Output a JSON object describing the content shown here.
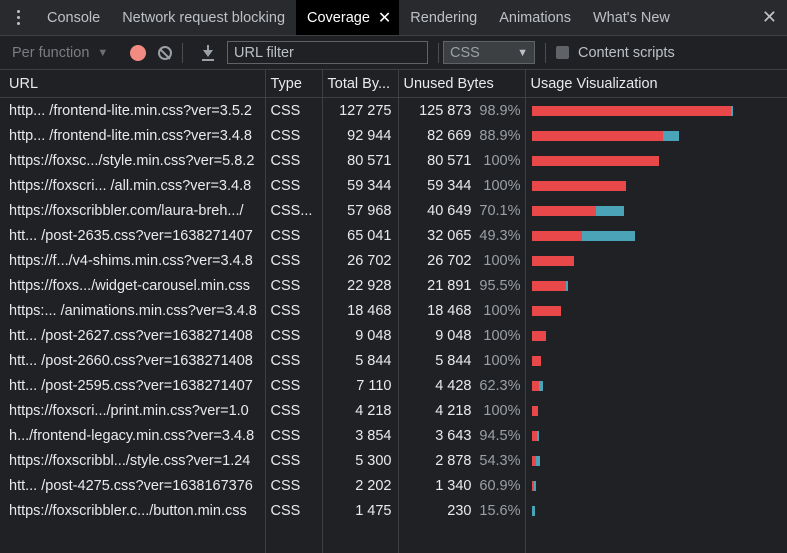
{
  "tabs": [
    {
      "label": "Console",
      "active": false
    },
    {
      "label": "Network request blocking",
      "active": false
    },
    {
      "label": "Coverage",
      "active": true
    },
    {
      "label": "Rendering",
      "active": false
    },
    {
      "label": "Animations",
      "active": false
    },
    {
      "label": "What's New",
      "active": false
    }
  ],
  "toolbar": {
    "mode_label": "Per function",
    "url_filter_placeholder": "URL filter",
    "type_filter_value": "CSS",
    "content_scripts_label": "Content scripts"
  },
  "columns": [
    "URL",
    "Type",
    "Total By...",
    "Unused Bytes",
    "Usage Visualization"
  ],
  "colors": {
    "unused": "#e8484a",
    "used": "#4aa3b6",
    "record": "#f28b82"
  },
  "rows": [
    {
      "url": "http... /frontend-lite.min.css?ver=3.5.2",
      "type": "CSS",
      "total": "127 275",
      "unused": "125 873",
      "pct": "98.9%",
      "total_n": 127275,
      "unused_n": 125873
    },
    {
      "url": "http... /frontend-lite.min.css?ver=3.4.8",
      "type": "CSS",
      "total": "92 944",
      "unused": "82 669",
      "pct": "88.9%",
      "total_n": 92944,
      "unused_n": 82669
    },
    {
      "url": "https://foxsc.../style.min.css?ver=5.8.2",
      "type": "CSS",
      "total": "80 571",
      "unused": "80 571",
      "pct": "100%",
      "total_n": 80571,
      "unused_n": 80571
    },
    {
      "url": "https://foxscri... /all.min.css?ver=3.4.8",
      "type": "CSS",
      "total": "59 344",
      "unused": "59 344",
      "pct": "100%",
      "total_n": 59344,
      "unused_n": 59344
    },
    {
      "url": "https://foxscribbler.com/laura-breh.../",
      "type": "CSS...",
      "total": "57 968",
      "unused": "40 649",
      "pct": "70.1%",
      "total_n": 57968,
      "unused_n": 40649
    },
    {
      "url": "htt... /post-2635.css?ver=1638271407",
      "type": "CSS",
      "total": "65 041",
      "unused": "32 065",
      "pct": "49.3%",
      "total_n": 65041,
      "unused_n": 32065
    },
    {
      "url": "https://f.../v4-shims.min.css?ver=3.4.8",
      "type": "CSS",
      "total": "26 702",
      "unused": "26 702",
      "pct": "100%",
      "total_n": 26702,
      "unused_n": 26702
    },
    {
      "url": "https://foxs.../widget-carousel.min.css",
      "type": "CSS",
      "total": "22 928",
      "unused": "21 891",
      "pct": "95.5%",
      "total_n": 22928,
      "unused_n": 21891
    },
    {
      "url": "https:... /animations.min.css?ver=3.4.8",
      "type": "CSS",
      "total": "18 468",
      "unused": "18 468",
      "pct": "100%",
      "total_n": 18468,
      "unused_n": 18468
    },
    {
      "url": "htt... /post-2627.css?ver=1638271408",
      "type": "CSS",
      "total": "9 048",
      "unused": "9 048",
      "pct": "100%",
      "total_n": 9048,
      "unused_n": 9048
    },
    {
      "url": "htt... /post-2660.css?ver=1638271408",
      "type": "CSS",
      "total": "5 844",
      "unused": "5 844",
      "pct": "100%",
      "total_n": 5844,
      "unused_n": 5844
    },
    {
      "url": "htt... /post-2595.css?ver=1638271407",
      "type": "CSS",
      "total": "7 110",
      "unused": "4 428",
      "pct": "62.3%",
      "total_n": 7110,
      "unused_n": 4428
    },
    {
      "url": "https://foxscri.../print.min.css?ver=1.0",
      "type": "CSS",
      "total": "4 218",
      "unused": "4 218",
      "pct": "100%",
      "total_n": 4218,
      "unused_n": 4218
    },
    {
      "url": "h.../frontend-legacy.min.css?ver=3.4.8",
      "type": "CSS",
      "total": "3 854",
      "unused": "3 643",
      "pct": "94.5%",
      "total_n": 3854,
      "unused_n": 3643
    },
    {
      "url": "https://foxscribbl.../style.css?ver=1.24",
      "type": "CSS",
      "total": "5 300",
      "unused": "2 878",
      "pct": "54.3%",
      "total_n": 5300,
      "unused_n": 2878
    },
    {
      "url": "htt... /post-4275.css?ver=1638167376",
      "type": "CSS",
      "total": "2 202",
      "unused": "1 340",
      "pct": "60.9%",
      "total_n": 2202,
      "unused_n": 1340
    },
    {
      "url": "https://foxscribbler.c.../button.min.css",
      "type": "CSS",
      "total": "1 475",
      "unused": "230",
      "pct": "15.6%",
      "total_n": 1475,
      "unused_n": 230
    }
  ]
}
